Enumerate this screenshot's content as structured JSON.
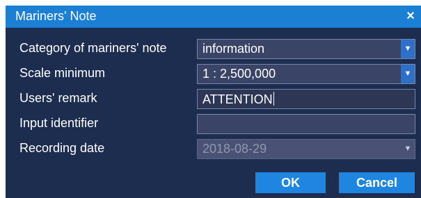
{
  "dialog": {
    "title": "Mariners' Note",
    "close_symbol": "×"
  },
  "fields": [
    {
      "label": "Category of mariners' note",
      "value": "information",
      "type": "select"
    },
    {
      "label": "Scale minimum",
      "value": "1 : 2,500,000",
      "type": "select"
    },
    {
      "label": "Users' remark",
      "value": "ATTENTION",
      "type": "text"
    },
    {
      "label": "Input identifier",
      "value": "",
      "type": "text"
    },
    {
      "label": "Recording date",
      "value": "2018-08-29",
      "type": "select",
      "disabled": true
    }
  ],
  "buttons": {
    "ok": "OK",
    "cancel": "Cancel"
  },
  "icons": {
    "dropdown": "chevron-down-icon",
    "close": "close-icon"
  },
  "colors": {
    "title_bar": "#1b7fd4",
    "panel_background": "#1c2d4f",
    "field_background": "#3a4467",
    "button": "#1e86e0"
  }
}
